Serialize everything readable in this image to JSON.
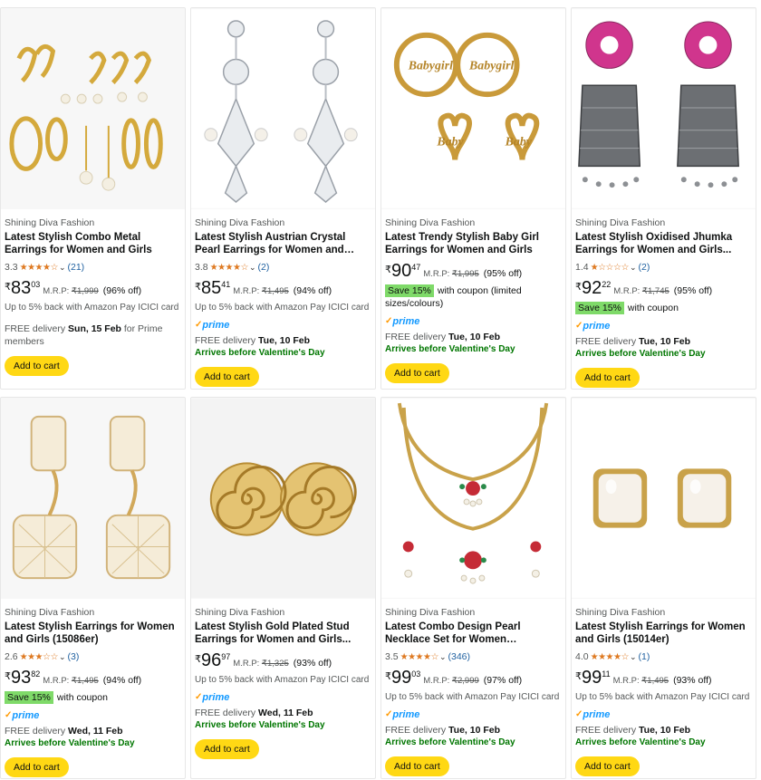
{
  "top_text": "",
  "colors": {
    "star": "#DE7921",
    "link": "#2162A1",
    "cart": "#FFD814",
    "save_badge": "#7FDA69",
    "prime": "#1399FF",
    "valentine": "#007600"
  },
  "products": [
    {
      "brand": "Shining Diva Fashion",
      "title": "Latest Stylish Combo Metal Earrings for Women and Girls",
      "rating_value": "3.3",
      "stars": "★★★★☆",
      "rating_count": "(21)",
      "currency": "₹",
      "price_whole": "83",
      "price_frac": "03",
      "mrp_label": "M.R.P:",
      "mrp": "₹1,999",
      "discount": "(96% off)",
      "cashback": "Up to 5% back with Amazon Pay ICICI card",
      "coupon_badge": "",
      "coupon_text": "",
      "prime": false,
      "delivery_label": "FREE delivery",
      "delivery_date": "Sun, 15 Feb",
      "delivery_suffix": " for Prime members",
      "arrival": "",
      "cart_label": "Add to cart",
      "image": "hoop-set"
    },
    {
      "brand": "Shining Diva Fashion",
      "title": "Latest Stylish Austrian Crystal Pearl Earrings for Women and Girls...",
      "rating_value": "3.8",
      "stars": "★★★★☆",
      "rating_count": "(2)",
      "currency": "₹",
      "price_whole": "85",
      "price_frac": "41",
      "mrp_label": "M.R.P:",
      "mrp": "₹1,495",
      "discount": "(94% off)",
      "cashback": "Up to 5% back with Amazon Pay ICICI card",
      "coupon_badge": "",
      "coupon_text": "",
      "prime": true,
      "prime_label": "prime",
      "delivery_label": "FREE delivery",
      "delivery_date": "Tue, 10 Feb",
      "delivery_suffix": "",
      "arrival": "Arrives before Valentine's Day",
      "cart_label": "Add to cart",
      "image": "crystal-drop"
    },
    {
      "brand": "Shining Diva Fashion",
      "title": "Latest Trendy Stylish Baby Girl Earrings for Women and Girls",
      "rating_value": "",
      "stars": "",
      "rating_count": "",
      "currency": "₹",
      "price_whole": "90",
      "price_frac": "47",
      "mrp_label": "M.R.P:",
      "mrp": "₹1,995",
      "discount": "(95% off)",
      "cashback": "",
      "coupon_badge": "Save 15%",
      "coupon_text": "with coupon (limited sizes/colours)",
      "prime": true,
      "prime_label": "prime",
      "delivery_label": "FREE delivery",
      "delivery_date": "Tue, 10 Feb",
      "delivery_suffix": "",
      "arrival": "Arrives before Valentine's Day",
      "cart_label": "Add to cart",
      "image": "babygirl-hoops"
    },
    {
      "brand": "Shining Diva Fashion",
      "title": "Latest Stylish Oxidised Jhumka Earrings for Women and Girls...",
      "rating_value": "1.4",
      "stars": "★☆☆☆☆",
      "rating_count": "(2)",
      "currency": "₹",
      "price_whole": "92",
      "price_frac": "22",
      "mrp_label": "M.R.P:",
      "mrp": "₹1,745",
      "discount": "(95% off)",
      "cashback": "",
      "coupon_badge": "Save 15%",
      "coupon_text": "with coupon",
      "prime": true,
      "prime_label": "prime",
      "delivery_label": "FREE delivery",
      "delivery_date": "Tue, 10 Feb",
      "delivery_suffix": "",
      "arrival": "Arrives before Valentine's Day",
      "cart_label": "Add to cart",
      "image": "jhumka"
    },
    {
      "brand": "Shining Diva Fashion",
      "title": "Latest Stylish Earrings for Women and Girls (15086er)",
      "rating_value": "2.6",
      "stars": "★★★☆☆",
      "rating_count": "(3)",
      "currency": "₹",
      "price_whole": "93",
      "price_frac": "82",
      "mrp_label": "M.R.P:",
      "mrp": "₹1,495",
      "discount": "(94% off)",
      "cashback": "",
      "coupon_badge": "Save 15%",
      "coupon_text": "with coupon",
      "prime": true,
      "prime_label": "prime",
      "delivery_label": "FREE delivery",
      "delivery_date": "Wed, 11 Feb",
      "delivery_suffix": "",
      "arrival": "Arrives before Valentine's Day",
      "cart_label": "Add to cart",
      "image": "cube-drop"
    },
    {
      "brand": "Shining Diva Fashion",
      "title": "Latest Stylish Gold Plated Stud Earrings for Women and Girls...",
      "rating_value": "",
      "stars": "",
      "rating_count": "",
      "currency": "₹",
      "price_whole": "96",
      "price_frac": "97",
      "mrp_label": "M.R.P:",
      "mrp": "₹1,325",
      "discount": "(93% off)",
      "cashback": "Up to 5% back with Amazon Pay ICICI card",
      "coupon_badge": "",
      "coupon_text": "",
      "prime": true,
      "prime_label": "prime",
      "delivery_label": "FREE delivery",
      "delivery_date": "Wed, 11 Feb",
      "delivery_suffix": "",
      "arrival": "Arrives before Valentine's Day",
      "cart_label": "Add to cart",
      "image": "spiral-stud"
    },
    {
      "brand": "Shining Diva Fashion",
      "title": "Latest Combo Design Pearl Necklace Set for Women Traditional Gold...",
      "rating_value": "3.5",
      "stars": "★★★★☆",
      "rating_count": "(346)",
      "currency": "₹",
      "price_whole": "99",
      "price_frac": "03",
      "mrp_label": "M.R.P:",
      "mrp": "₹2,999",
      "discount": "(97% off)",
      "cashback": "Up to 5% back with Amazon Pay ICICI card",
      "coupon_badge": "",
      "coupon_text": "",
      "prime": true,
      "prime_label": "prime",
      "delivery_label": "FREE delivery",
      "delivery_date": "Tue, 10 Feb",
      "delivery_suffix": "",
      "arrival": "Arrives before Valentine's Day",
      "cart_label": "Add to cart",
      "image": "necklace"
    },
    {
      "brand": "Shining Diva Fashion",
      "title": "Latest Stylish Earrings for Women and Girls (15014er)",
      "rating_value": "4.0",
      "stars": "★★★★☆",
      "rating_count": "(1)",
      "currency": "₹",
      "price_whole": "99",
      "price_frac": "11",
      "mrp_label": "M.R.P:",
      "mrp": "₹1,495",
      "discount": "(93% off)",
      "cashback": "Up to 5% back with Amazon Pay ICICI card",
      "coupon_badge": "",
      "coupon_text": "",
      "prime": true,
      "prime_label": "prime",
      "delivery_label": "FREE delivery",
      "delivery_date": "Tue, 10 Feb",
      "delivery_suffix": "",
      "arrival": "Arrives before Valentine's Day",
      "cart_label": "Add to cart",
      "image": "pearl-square-stud"
    }
  ]
}
